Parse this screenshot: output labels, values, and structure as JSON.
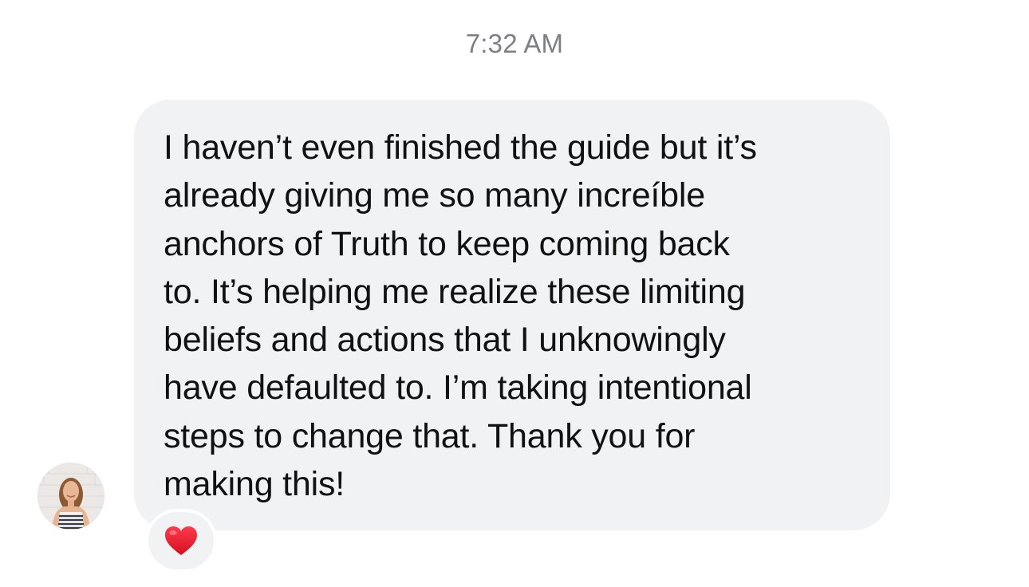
{
  "conversation": {
    "timestamp": "7:32 AM",
    "message": {
      "text": "I haven’t even finished the guide but it’s\nalready giving me so many increíble\nanchors of Truth to keep coming back\nto. It’s helping me realize these limiting\nbeliefs and actions that I unknowingly\nhave defaulted to. I’m taking intentional\nsteps to change that. Thank you for\nmaking this!",
      "bubble_color": "#f1f2f4"
    },
    "reaction": {
      "icon": "red-heart-icon",
      "color": "#e0182d"
    },
    "sender": {
      "avatar_icon": "avatar-photo"
    }
  }
}
